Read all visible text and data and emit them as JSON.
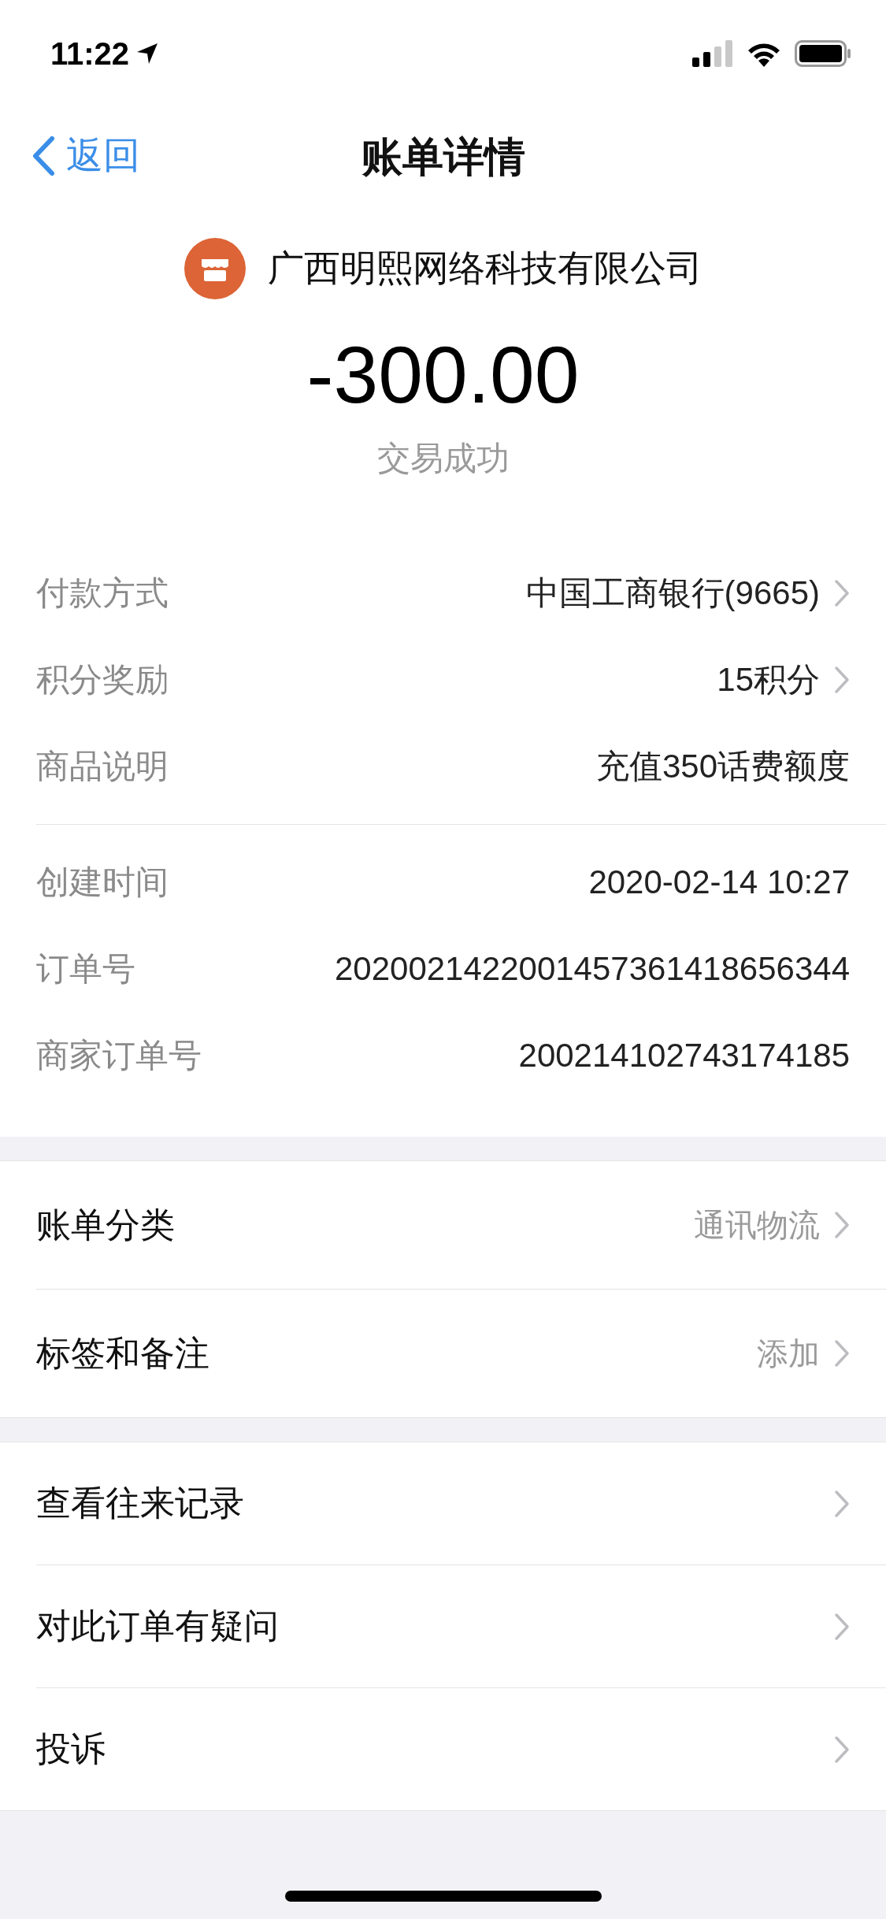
{
  "status_bar": {
    "time": "11:22"
  },
  "nav": {
    "back": "返回",
    "title": "账单详情"
  },
  "merchant": {
    "name": "广西明熙网络科技有限公司"
  },
  "amount": "-300.00",
  "status": "交易成功",
  "details": [
    [
      {
        "label": "付款方式",
        "value": "中国工商银行(9665)",
        "arrow": true
      },
      {
        "label": "积分奖励",
        "value": "15积分",
        "arrow": true
      },
      {
        "label": "商品说明",
        "value": "充值350话费额度",
        "arrow": false
      }
    ],
    [
      {
        "label": "创建时间",
        "value": "2020-02-14 10:27",
        "arrow": false
      },
      {
        "label": "订单号",
        "value": "2020021422001457361418656344",
        "arrow": false
      },
      {
        "label": "商家订单号",
        "value": "200214102743174185",
        "arrow": false
      }
    ]
  ],
  "menu_groups": [
    [
      {
        "label": "账单分类",
        "value": "通讯物流"
      },
      {
        "label": "标签和备注",
        "value": "添加"
      }
    ],
    [
      {
        "label": "查看往来记录"
      },
      {
        "label": "对此订单有疑问"
      },
      {
        "label": "投诉"
      }
    ]
  ]
}
